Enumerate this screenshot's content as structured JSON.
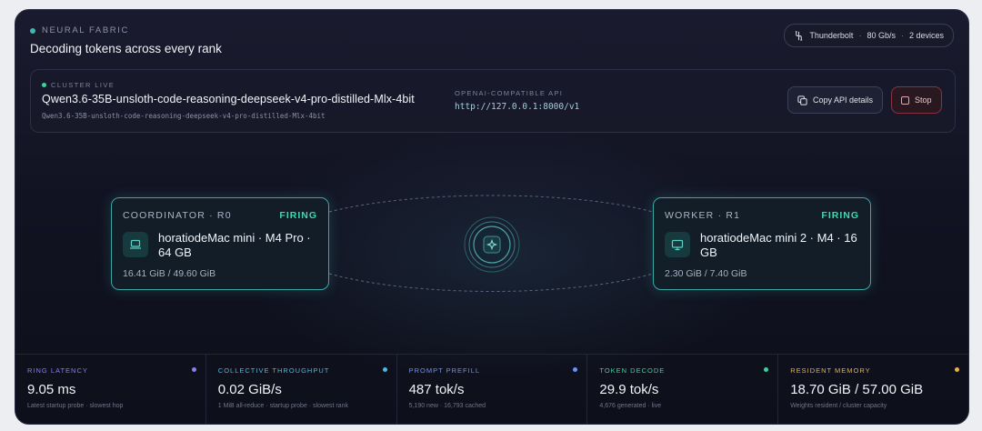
{
  "header": {
    "eyebrow": "NEURAL FABRIC",
    "title": "Decoding tokens across every rank",
    "link_type": "Thunderbolt",
    "link_speed": "80 Gb/s",
    "device_count": "2 devices",
    "link_icon": "cable-icon"
  },
  "cluster": {
    "status_label": "CLUSTER LIVE",
    "model_name": "Qwen3.6-35B-unsloth-code-reasoning-deepseek-v4-pro-distilled-Mlx-4bit",
    "model_id": "Qwen3.6-35B-unsloth-code-reasoning-deepseek-v4-pro-distilled-Mlx-4bit",
    "api_label": "OPENAI-COMPATIBLE API",
    "api_url": "http://127.0.0.1:8000/v1",
    "copy_label": "Copy API details",
    "stop_label": "Stop",
    "copy_icon": "copy-icon",
    "stop_icon": "stop-icon"
  },
  "nodes": [
    {
      "role": "COORDINATOR · R0",
      "status": "FIRING",
      "name": "horatiodeMac mini · M4 Pro · 64 GB",
      "memory": "16.41 GiB / 49.60 GiB",
      "icon": "laptop-icon"
    },
    {
      "role": "WORKER · R1",
      "status": "FIRING",
      "name": "horatiodeMac mini 2 · M4 · 16 GB",
      "memory": "2.30 GiB / 7.40 GiB",
      "icon": "monitor-icon"
    }
  ],
  "hub": {
    "icon": "sparkle-icon"
  },
  "stats": [
    {
      "label": "RING LATENCY",
      "value": "9.05 ms",
      "sub": "Latest startup probe · slowest hop",
      "color": "#8b7cf0"
    },
    {
      "label": "COLLECTIVE THROUGHPUT",
      "value": "0.02 GiB/s",
      "sub": "1 MiB all-reduce · startup probe · slowest rank",
      "color": "#4ab8e0"
    },
    {
      "label": "PROMPT PREFILL",
      "value": "487 tok/s",
      "sub": "5,190 new · 16,793 cached",
      "color": "#6c93f0"
    },
    {
      "label": "TOKEN DECODE",
      "value": "29.9 tok/s",
      "sub": "4,676 generated · live",
      "color": "#3fcf9e"
    },
    {
      "label": "RESIDENT MEMORY",
      "value": "18.70 GiB / 57.00 GiB",
      "sub": "Weights resident / cluster capacity",
      "color": "#e9b04a"
    }
  ]
}
